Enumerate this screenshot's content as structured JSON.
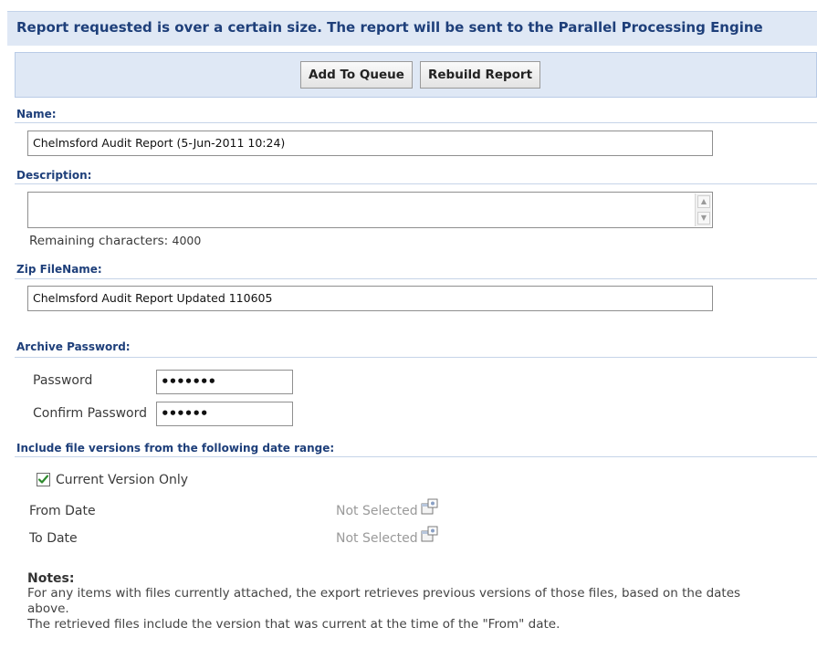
{
  "banner": {
    "message": "Report requested is over a certain size. The report will be sent to the Parallel Processing Engine"
  },
  "toolbar": {
    "add_to_queue_label": "Add To Queue",
    "rebuild_report_label": "Rebuild Report"
  },
  "name": {
    "label": "Name:",
    "value": "Chelmsford Audit Report (5-Jun-2011 10:24)"
  },
  "description": {
    "label": "Description:",
    "value": "",
    "remaining_label": "Remaining characters:",
    "remaining_count": "4000"
  },
  "zip_filename": {
    "label": "Zip FileName:",
    "value": "Chelmsford Audit Report Updated 110605"
  },
  "archive_password": {
    "label": "Archive Password:",
    "password_label": "Password",
    "password_mask": "•••••••",
    "confirm_label": "Confirm Password",
    "confirm_mask": "••••••"
  },
  "date_range": {
    "label": "Include file versions from the following date range:",
    "current_version_only_label": "Current Version Only",
    "current_version_only_checked": true,
    "from_label": "From Date",
    "from_value": "Not Selected",
    "to_label": "To Date",
    "to_value": "Not Selected"
  },
  "notes": {
    "title": "Notes:",
    "line1": "For any items with files currently attached, the export retrieves previous versions of those files, based on the dates",
    "line2": "above.",
    "line3": "The retrieved files include the version that was current at the time of the \"From\" date."
  },
  "colors": {
    "banner_bg": "#dfe8f5",
    "section_label": "#1e3f7a",
    "checkmark": "#2e8b2e"
  }
}
